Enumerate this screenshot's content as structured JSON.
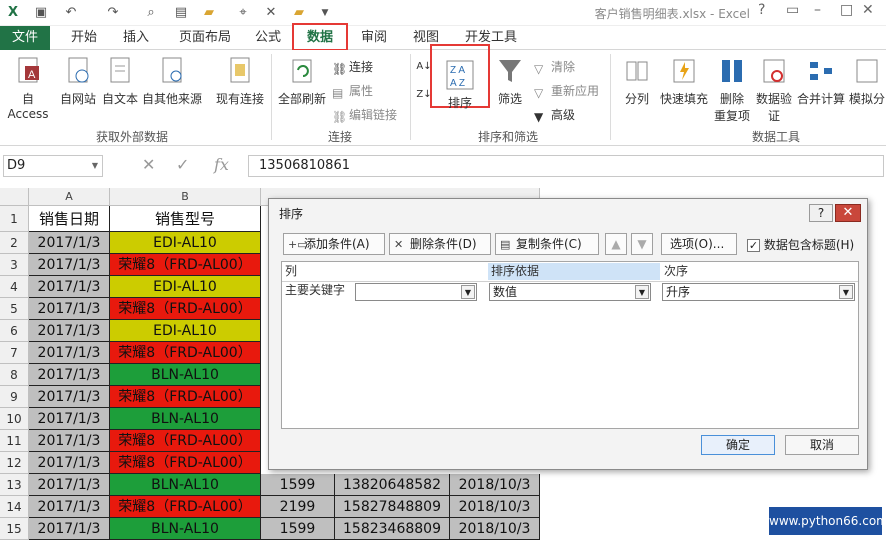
{
  "window": {
    "title": "客户销售明细表.xlsx - Excel"
  },
  "ribbon_tabs": [
    "文件",
    "开始",
    "插入",
    "页面布局",
    "公式",
    "数据",
    "审阅",
    "视图",
    "开发工具"
  ],
  "ribbon": {
    "get_external": {
      "access": "自 Access",
      "web": "自网站",
      "text": "自文本",
      "other": "自其他来源",
      "existing": "现有连接",
      "label": "获取外部数据"
    },
    "connections": {
      "refresh_all": "全部刷新",
      "connections": "连接",
      "properties": "属性",
      "edit_links": "编辑链接",
      "label": "连接"
    },
    "sort_filter": {
      "sort": "排序",
      "filter": "筛选",
      "clear": "清除",
      "reapply": "重新应用",
      "advanced": "高级",
      "label": "排序和筛选"
    },
    "data_tools": {
      "split": "分列",
      "flash_fill": "快速填充",
      "remove_dup_1": "删除",
      "remove_dup_2": "重复项",
      "validation_1": "数据验",
      "validation_2": "证",
      "consolidate": "合并计算",
      "whatif": "模拟分",
      "label": "数据工具"
    }
  },
  "formula_bar": {
    "name_box": "D9",
    "fx": "fx",
    "value": "13506810861"
  },
  "columns": [
    "A",
    "B"
  ],
  "header_row": {
    "a": "销售日期",
    "b": "销售型号"
  },
  "rows": [
    {
      "num": "2",
      "a": "2017/1/3",
      "b": "EDI-AL10",
      "color": "yellow"
    },
    {
      "num": "3",
      "a": "2017/1/3",
      "b": "荣耀8（FRD-AL00）",
      "color": "red"
    },
    {
      "num": "4",
      "a": "2017/1/3",
      "b": "EDI-AL10",
      "color": "yellow"
    },
    {
      "num": "5",
      "a": "2017/1/3",
      "b": "荣耀8（FRD-AL00）",
      "color": "red"
    },
    {
      "num": "6",
      "a": "2017/1/3",
      "b": "EDI-AL10",
      "color": "yellow"
    },
    {
      "num": "7",
      "a": "2017/1/3",
      "b": "荣耀8（FRD-AL00）",
      "color": "red"
    },
    {
      "num": "8",
      "a": "2017/1/3",
      "b": "BLN-AL10",
      "color": "green"
    },
    {
      "num": "9",
      "a": "2017/1/3",
      "b": "荣耀8（FRD-AL00）",
      "color": "red"
    },
    {
      "num": "10",
      "a": "2017/1/3",
      "b": "BLN-AL10",
      "color": "green"
    },
    {
      "num": "11",
      "a": "2017/1/3",
      "b": "荣耀8（FRD-AL00）",
      "color": "red"
    },
    {
      "num": "12",
      "a": "2017/1/3",
      "b": "荣耀8（FRD-AL00）",
      "color": "red"
    },
    {
      "num": "13",
      "a": "2017/1/3",
      "b": "BLN-AL10",
      "color": "green",
      "c": "1599",
      "d": "13820648582",
      "e": "2018/10/3"
    },
    {
      "num": "14",
      "a": "2017/1/3",
      "b": "荣耀8（FRD-AL00）",
      "color": "red",
      "c": "2199",
      "d": "15827848809",
      "e": "2018/10/3"
    },
    {
      "num": "15",
      "a": "2017/1/3",
      "b": "BLN-AL10",
      "color": "green",
      "c": "1599",
      "d": "15823468809",
      "e": "2018/10/3"
    }
  ],
  "dialog": {
    "title": "排序",
    "help": "?",
    "add_level": "添加条件(A)",
    "delete_level": "删除条件(D)",
    "copy_level": "复制条件(C)",
    "options": "选项(O)...",
    "has_headers": "数据包含标题(H)",
    "has_headers_checked": true,
    "col_header": "列",
    "sort_on_header": "排序依据",
    "order_header": "次序",
    "row_label": "主要关键字",
    "column_value": "",
    "sort_on_value": "数值",
    "order_value": "升序",
    "ok": "确定",
    "cancel": "取消"
  },
  "watermark": "www.python66.com",
  "colors": {
    "excel_green": "#217346",
    "highlight_red": "#e53935",
    "row_yellow": "#cccc00",
    "row_red": "#e8190d",
    "row_green": "#1d9e3a",
    "gray": "#bfbfbf"
  }
}
